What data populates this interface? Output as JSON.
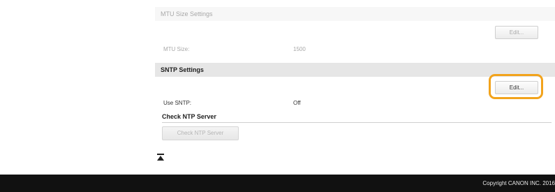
{
  "mtu_settings": {
    "title": "MTU Size Settings",
    "edit_label": "Edit...",
    "mtu_size_label": "MTU Size:",
    "mtu_size_value": "1500"
  },
  "sntp_settings": {
    "title": "SNTP Settings",
    "edit_label": "Edit...",
    "use_sntp_label": "Use SNTP:",
    "use_sntp_value": "Off",
    "check_ntp_server_title": "Check NTP Server",
    "check_ntp_server_button": "Check NTP Server"
  },
  "top_link_icon": "go-to-top-icon",
  "footer": {
    "copyright": "Copyright CANON INC. 2016"
  },
  "colors": {
    "highlight": "#f2a31c",
    "footer_bg": "#111111",
    "header_bg": "#e6e6e6"
  }
}
